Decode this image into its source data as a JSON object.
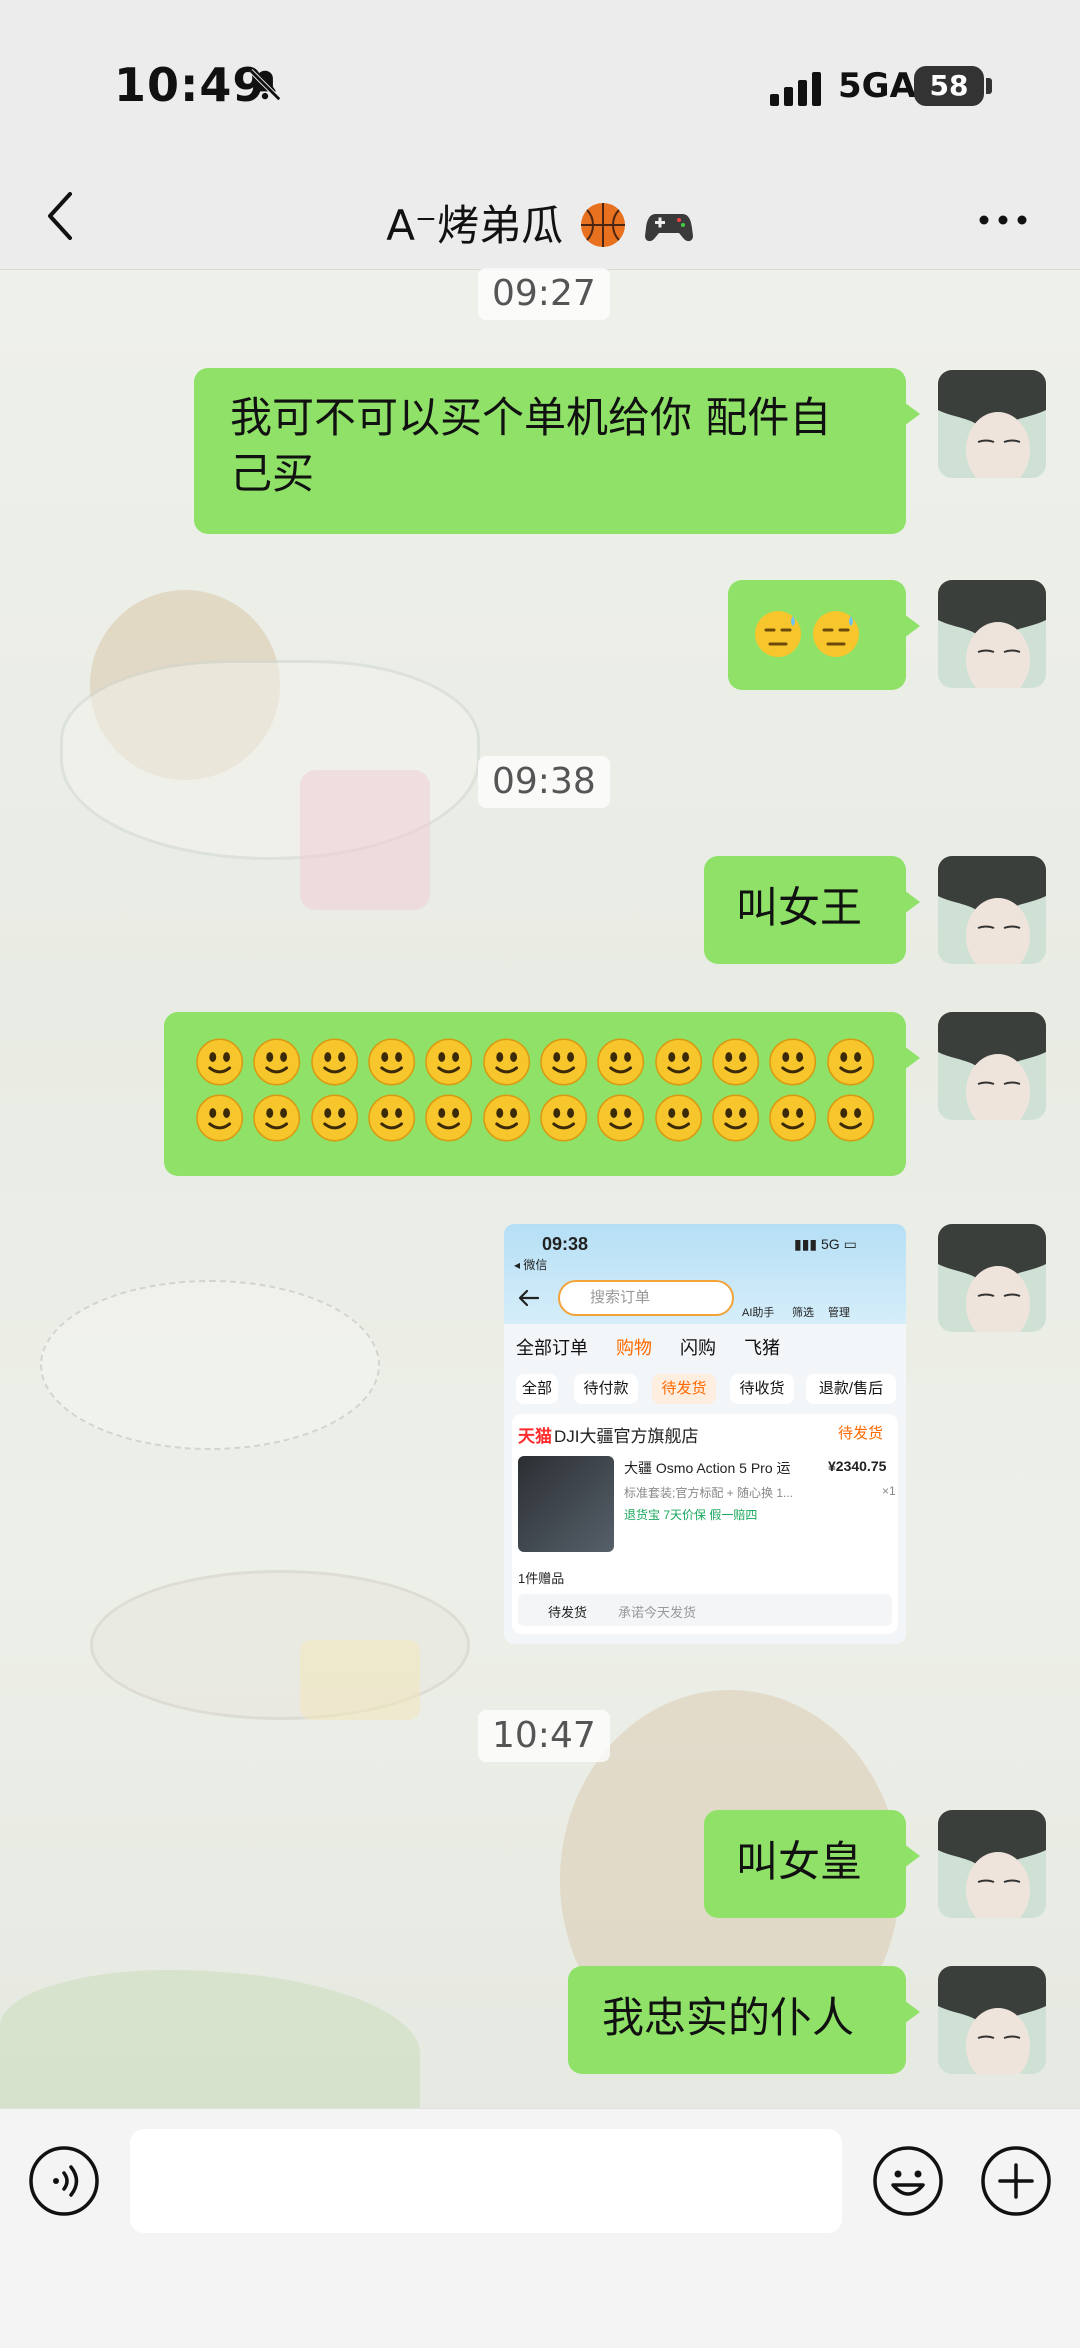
{
  "status": {
    "time": "10:49",
    "network": "5GA",
    "battery": "58"
  },
  "nav": {
    "title": "A⁻烤弟瓜"
  },
  "timestamps": [
    "09:27",
    "09:38",
    "10:47"
  ],
  "messages": [
    {
      "text": "我可不可以买个单机给你 配件自己买"
    },
    {
      "text": "叫女王"
    },
    {
      "text": "叫女皇"
    },
    {
      "text": "我忠实的仆人"
    }
  ],
  "shot": {
    "time": "09:38",
    "back_app": "◂ 微信",
    "search_placeholder": "搜索订单",
    "tools": [
      "AI助手",
      "筛选",
      "管理"
    ],
    "tabs": [
      "全部订单",
      "购物",
      "闪购",
      "飞猪"
    ],
    "chips": [
      "全部",
      "待付款",
      "待发货",
      "待收货",
      "退款/售后"
    ],
    "store": "DJI大疆官方旗舰店",
    "store_brand": "天猫",
    "status": "待发货",
    "product": "大疆 Osmo Action 5 Pro 运",
    "price": "¥2340.75",
    "spec": "标准套装;官方标配 + 随心换 1...",
    "qty": "×1",
    "tags": "退货宝  7天价保  假一赔四",
    "gift": "1件赠品",
    "footer_label": "待发货",
    "footer_note": "承诺今天发货"
  },
  "colors": {
    "bubble": "#8fe267",
    "accent": "#f2a33a"
  },
  "icons": [
    "back-icon",
    "more-icon",
    "voice-icon",
    "emoji-icon",
    "plus-icon"
  ]
}
